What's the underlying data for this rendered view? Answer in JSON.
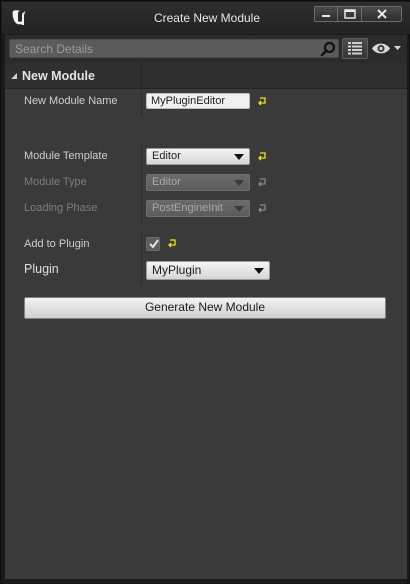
{
  "window": {
    "title": "Create New Module"
  },
  "search": {
    "placeholder": "Search Details"
  },
  "category": {
    "title": "New Module"
  },
  "properties": {
    "module_name": {
      "label": "New Module Name",
      "value": "MyPluginEditor"
    },
    "module_template": {
      "label": "Module Template",
      "value": "Editor"
    },
    "module_type": {
      "label": "Module Type",
      "value": "Editor"
    },
    "loading_phase": {
      "label": "Loading Phase",
      "value": "PostEngineInit"
    },
    "add_to_plugin": {
      "label": "Add to Plugin",
      "checked": true
    },
    "plugin": {
      "label": "Plugin",
      "value": "MyPlugin"
    }
  },
  "actions": {
    "generate_label": "Generate New Module"
  },
  "colors": {
    "panel_bg": "#3a3a3a",
    "titlebar_bg": "#2a2a2a",
    "reset_arrow_active": "#e6e61a",
    "reset_arrow_inactive": "#8a8a8a"
  },
  "icons": {
    "logo": "unreal-logo-icon",
    "search": "search-icon",
    "view_options": "view-options-icon",
    "visibility": "eye-icon",
    "reset": "reset-to-default-icon"
  }
}
